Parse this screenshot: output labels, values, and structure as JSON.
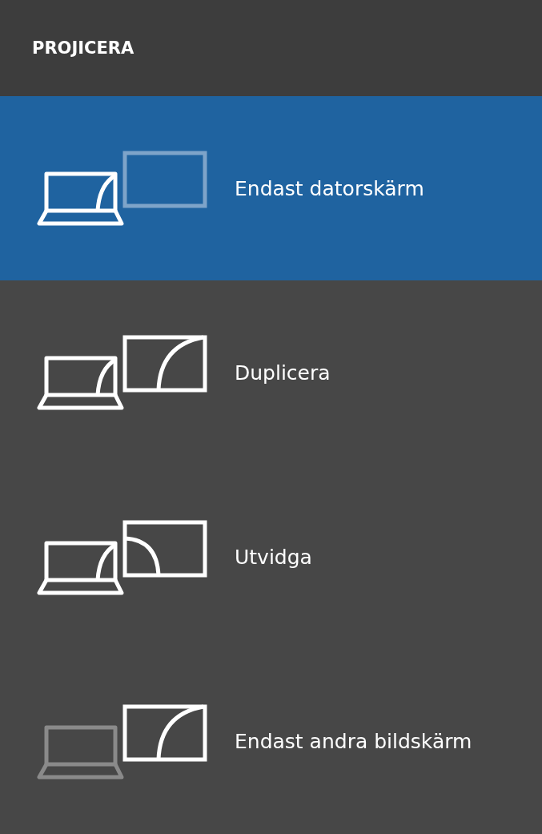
{
  "panel": {
    "title": "PROJICERA"
  },
  "items": [
    {
      "label": "Endast datorskärm",
      "kind": "pc-only",
      "selected": true
    },
    {
      "label": "Duplicera",
      "kind": "duplicate",
      "selected": false
    },
    {
      "label": "Utvidga",
      "kind": "extend",
      "selected": false
    },
    {
      "label": "Endast andra bildskärm",
      "kind": "second-only",
      "selected": false
    }
  ]
}
